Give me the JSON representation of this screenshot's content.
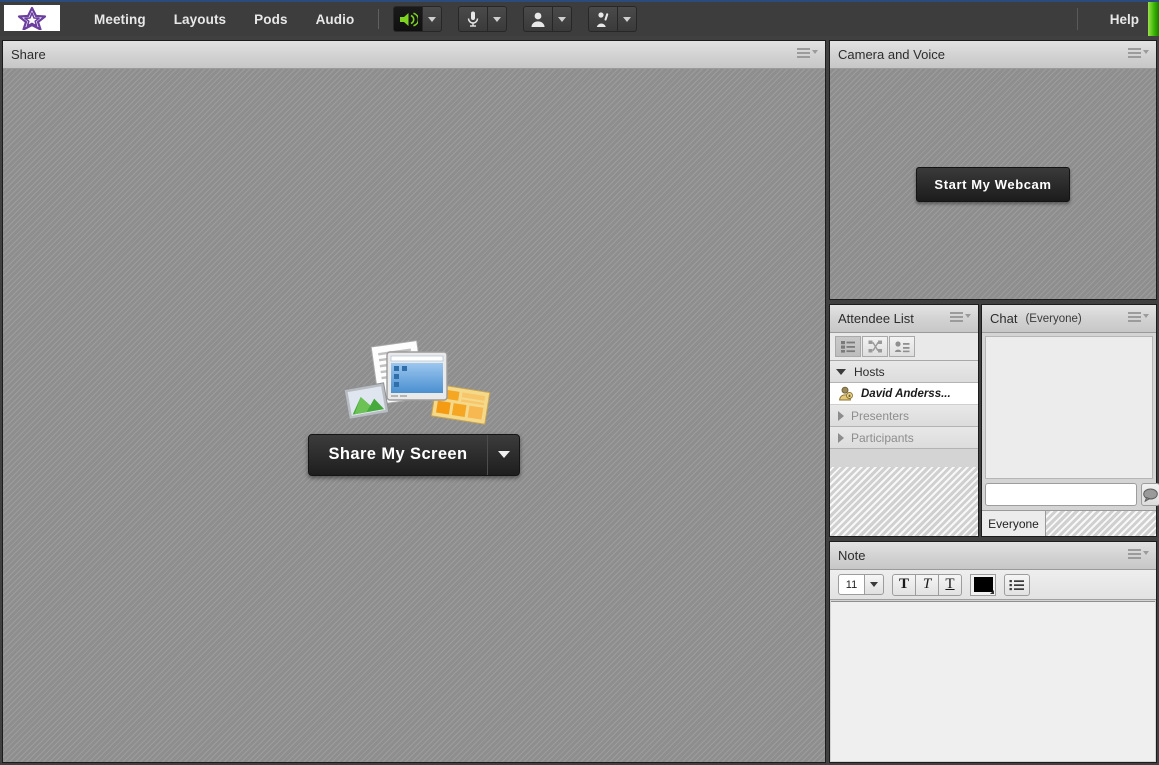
{
  "menubar": {
    "logo_alt": "purple-star-logo",
    "items": [
      {
        "label": "Meeting"
      },
      {
        "label": "Layouts"
      },
      {
        "label": "Pods"
      },
      {
        "label": "Audio"
      }
    ],
    "tools": [
      {
        "name": "speaker",
        "state": "on",
        "has_dropdown": true
      },
      {
        "name": "microphone",
        "state": "off",
        "has_dropdown": true
      },
      {
        "name": "camera",
        "state": "off",
        "has_dropdown": true
      },
      {
        "name": "raise-hand",
        "state": "off",
        "has_dropdown": true
      }
    ],
    "help_label": "Help",
    "accent_green": "#35b200"
  },
  "share_pod": {
    "title": "Share",
    "button_label": "Share My Screen",
    "dropdown": true
  },
  "camera_pod": {
    "title": "Camera and Voice",
    "button_label": "Start My Webcam"
  },
  "attendee_pod": {
    "title": "Attendee List",
    "view_buttons": [
      {
        "name": "list-view",
        "selected": true
      },
      {
        "name": "breakout-view",
        "selected": false
      },
      {
        "name": "attendee-info-view",
        "selected": false
      }
    ],
    "groups": [
      {
        "label": "Hosts",
        "expanded": true,
        "members": [
          {
            "name": "David Anderss...",
            "role_icon": "host-avatar-icon"
          }
        ]
      },
      {
        "label": "Presenters",
        "expanded": false,
        "members": []
      },
      {
        "label": "Participants",
        "expanded": false,
        "members": []
      }
    ]
  },
  "chat_pod": {
    "title": "Chat",
    "scope": "(Everyone)",
    "messages": [],
    "input_value": "",
    "input_placeholder": "",
    "send_icon": "chat-bubble-icon",
    "tabs": [
      {
        "label": "Everyone",
        "active": true
      }
    ]
  },
  "note_pod": {
    "title": "Note",
    "font_size": "11",
    "format_buttons": [
      {
        "name": "bold",
        "glyph": "T"
      },
      {
        "name": "italic",
        "glyph": "T"
      },
      {
        "name": "underline",
        "glyph": "T"
      }
    ],
    "text_color": "#000000",
    "list_button": "bullet-list",
    "body_text": ""
  }
}
